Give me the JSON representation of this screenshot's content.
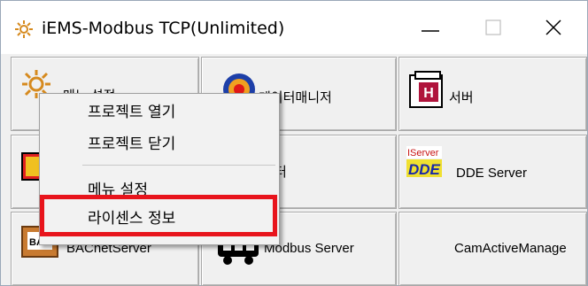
{
  "window": {
    "title": "iEMS-Modbus TCP(Unlimited)",
    "minimize_glyph": "—",
    "maximize_glyph": "☐",
    "close_glyph": "✕"
  },
  "grid": {
    "row1": [
      "메뉴 설정",
      "데이터매니저",
      "서버"
    ],
    "row2": [
      "",
      "터",
      "DDE Server"
    ],
    "row2_badge": "IServer",
    "row2_dde": "DDE",
    "row3": [
      "BACnetServer",
      "Modbus Server",
      "CamActiveManage"
    ],
    "bac_badge": "BAC"
  },
  "context_menu": {
    "items": [
      "프로젝트 열기",
      "프로젝트 닫기",
      "메뉴 설정",
      "라이센스 정보"
    ]
  },
  "colors": {
    "highlight": "#e8141c"
  }
}
